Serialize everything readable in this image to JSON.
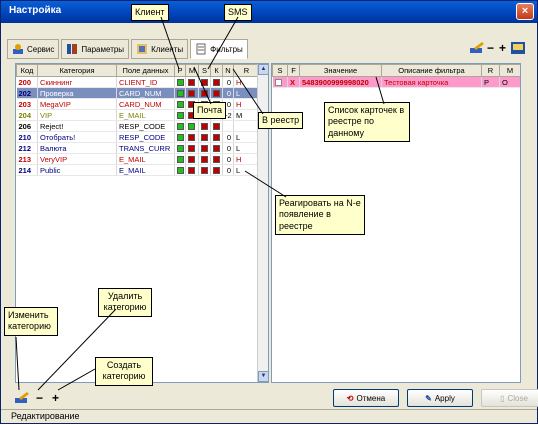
{
  "window": {
    "title": "Настройка",
    "close": "×"
  },
  "toolbar": {
    "tabs": [
      "Сервис",
      "Параметры",
      "Клиенты",
      "Фильтры"
    ]
  },
  "left_table": {
    "headers": [
      "Код",
      "Категория",
      "Поле данных",
      "Р",
      "М",
      "S",
      "К",
      "N",
      "R"
    ],
    "rows": [
      {
        "code": "200",
        "name": "Скиннинг",
        "field": "CLIENT_ID",
        "flags": [
          "g",
          "r",
          "r",
          "r"
        ],
        "n": "0",
        "r": "H",
        "color": "#c00000"
      },
      {
        "code": "202",
        "name": "Проверка",
        "field": "CARD_NUM",
        "flags": [
          "g",
          "r",
          "r",
          "r"
        ],
        "n": "0",
        "r": "L",
        "color": "#000080",
        "selected": true
      },
      {
        "code": "203",
        "name": "MegaVIP",
        "field": "CARD_NUM",
        "flags": [
          "g",
          "r",
          "r",
          "r"
        ],
        "n": "0",
        "r": "H",
        "color": "#c00000"
      },
      {
        "code": "204",
        "name": "VIP",
        "field": "E_MAIL",
        "flags": [
          "g",
          "r",
          "r",
          "g"
        ],
        "n": "-2",
        "r": "M",
        "color": "#808000"
      },
      {
        "code": "206",
        "name": "Reject!",
        "field": "RESP_CODE",
        "flags": [
          "g",
          "g",
          "r",
          "r"
        ],
        "n": "",
        "r": "",
        "color": "#000"
      },
      {
        "code": "210",
        "name": "Отобрать!",
        "field": "RESP_CODE",
        "flags": [
          "g",
          "r",
          "r",
          "r"
        ],
        "n": "0",
        "r": "L",
        "color": "#000080"
      },
      {
        "code": "212",
        "name": "Валюта",
        "field": "TRANS_CURR",
        "flags": [
          "g",
          "r",
          "r",
          "r"
        ],
        "n": "0",
        "r": "L",
        "color": "#000080"
      },
      {
        "code": "213",
        "name": "VeryVIP",
        "field": "E_MAIL",
        "flags": [
          "g",
          "r",
          "r",
          "r"
        ],
        "n": "0",
        "r": "H",
        "color": "#c00000"
      },
      {
        "code": "214",
        "name": "Public",
        "field": "E_MAIL",
        "flags": [
          "g",
          "r",
          "r",
          "r"
        ],
        "n": "0",
        "r": "L",
        "color": "#000080"
      }
    ]
  },
  "right_table": {
    "headers": [
      "S",
      "F",
      "Значение",
      "Описание фильтра",
      "R",
      "M"
    ],
    "row": {
      "s": "",
      "f": "X",
      "value": "5483900999998020",
      "desc": "Тестовая карточка",
      "r": "P",
      "m": "O"
    }
  },
  "callouts": {
    "client": "Клиент",
    "sms": "SMS",
    "mail": "Почта",
    "registry": "В реестр",
    "card_list": "Список карточек в реестре по данному",
    "react": "Реагировать на N-е появление в реестре",
    "delete": "Удалить категорию",
    "edit": "Изменить категорию",
    "create": "Создать категорию"
  },
  "buttons": {
    "cancel": "Отмена",
    "apply": "Apply",
    "close": "Close"
  },
  "status": "Редактирование"
}
